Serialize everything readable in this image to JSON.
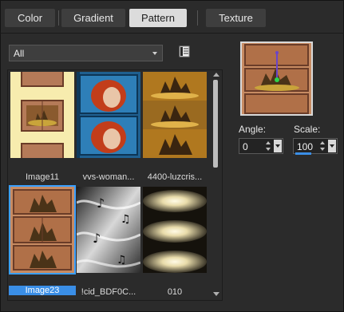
{
  "tabs": [
    {
      "label": "Color",
      "active": false
    },
    {
      "label": "Gradient",
      "active": false
    },
    {
      "label": "Pattern",
      "active": true
    },
    {
      "label": "Texture",
      "active": false
    }
  ],
  "filter": {
    "selected": "All"
  },
  "icons": {
    "view_toggle": "list-view-icon",
    "dropdown_arrow": "chevron-down-icon"
  },
  "gallery": {
    "items": [
      {
        "name": "Image11",
        "selected": false
      },
      {
        "name": "vvs-woman...",
        "selected": false
      },
      {
        "name": "4400-luzcris...",
        "selected": false
      },
      {
        "name": "Image23",
        "selected": true
      },
      {
        "name": "!cid_BDF0C...",
        "selected": false
      },
      {
        "name": "010",
        "selected": false
      }
    ]
  },
  "controls": {
    "angle_label": "Angle:",
    "angle_value": "0",
    "scale_label": "Scale:",
    "scale_value": "100"
  },
  "colors": {
    "accent": "#3a8ee6",
    "selection": "#3aa0ff"
  }
}
